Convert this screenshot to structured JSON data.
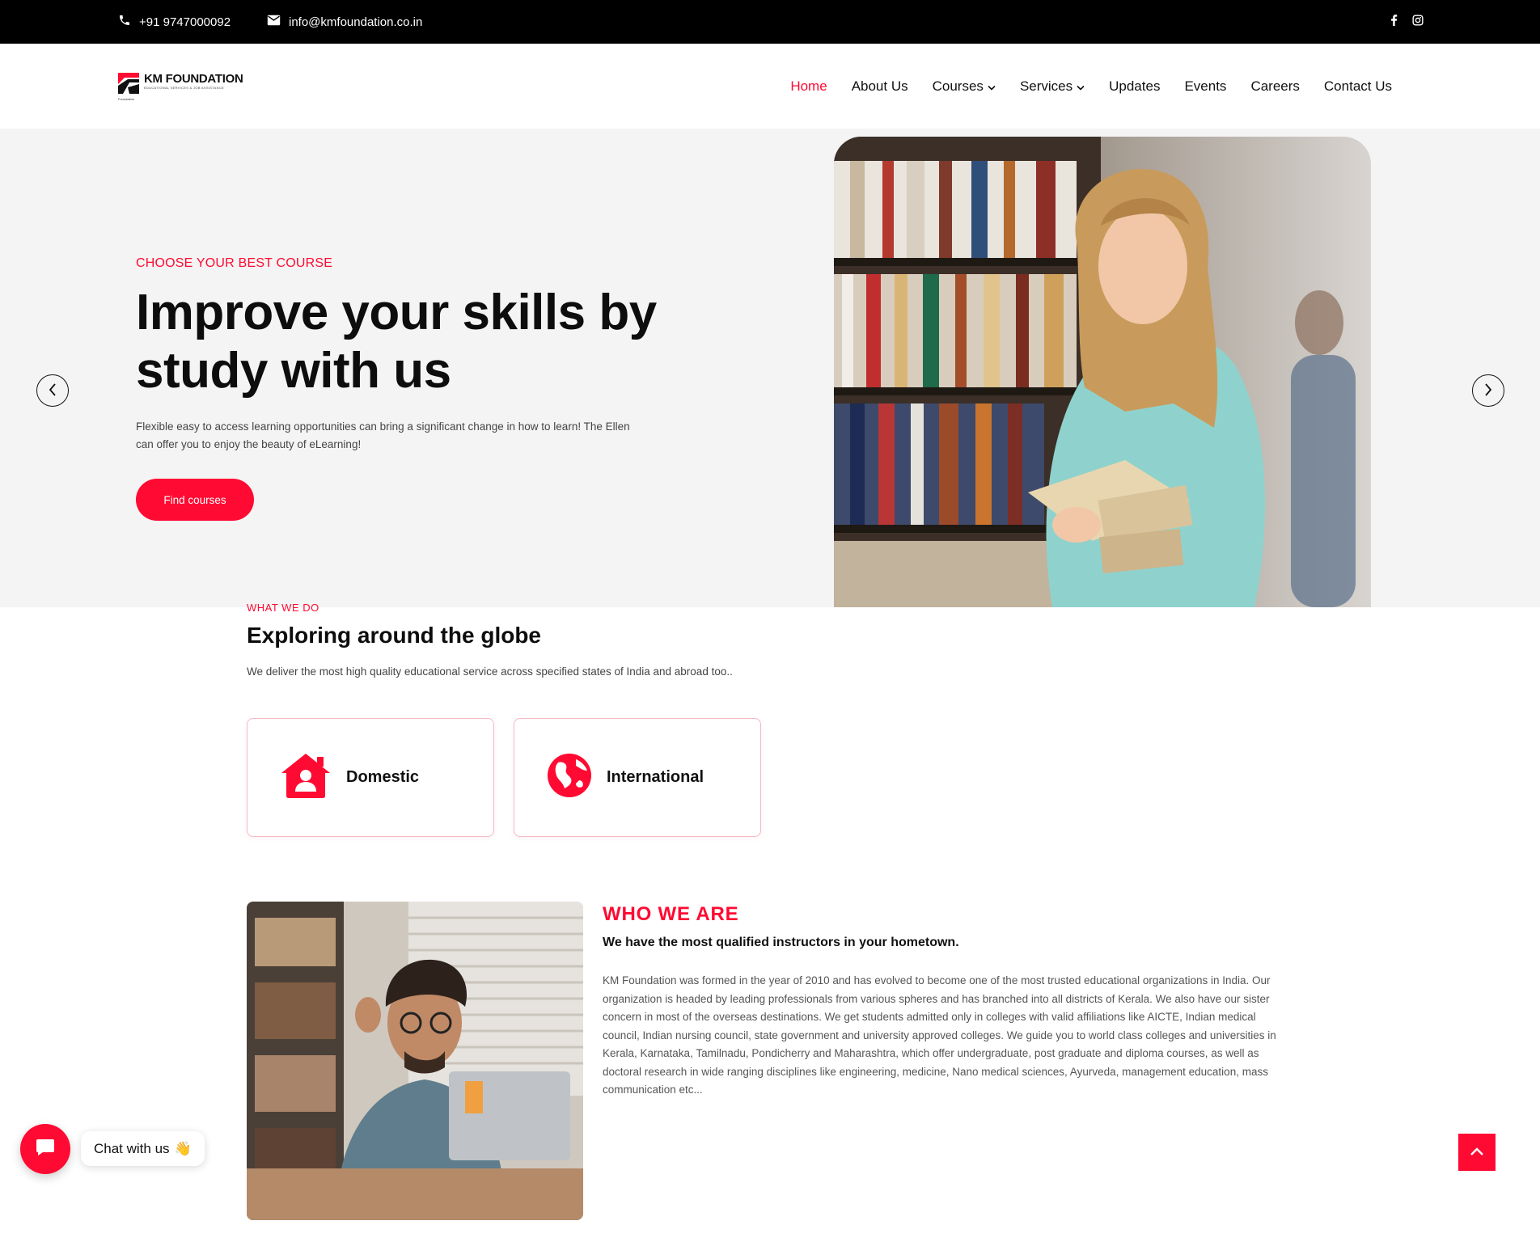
{
  "topbar": {
    "phone": "+91 9747000092",
    "email": "info@kmfoundation.co.in",
    "social": [
      "facebook-icon",
      "instagram-icon"
    ]
  },
  "logo": {
    "name": "KM FOUNDATION",
    "tagline": "EDUCATIONAL SERVICES & JOB ASSISTANCE",
    "sub": "Foundation"
  },
  "nav": {
    "items": [
      {
        "label": "Home",
        "active": true
      },
      {
        "label": "About Us"
      },
      {
        "label": "Courses",
        "dropdown": true
      },
      {
        "label": "Services",
        "dropdown": true
      },
      {
        "label": "Updates"
      },
      {
        "label": "Events"
      },
      {
        "label": "Careers"
      },
      {
        "label": "Contact Us"
      }
    ]
  },
  "hero": {
    "kicker": "CHOOSE YOUR BEST COURSE",
    "title": "Improve your skills by study with us",
    "description": "Flexible easy to access learning opportunities can bring a significant change in how to learn! The Ellen can offer you to enjoy the beauty of eLearning!",
    "button": "Find courses"
  },
  "what_we_do": {
    "kicker": "WHAT WE DO",
    "title": "Exploring around the globe",
    "description": "We deliver the most high quality educational service across specified states of India and abroad too..",
    "cards": [
      {
        "label": "Domestic",
        "icon": "house-user-icon"
      },
      {
        "label": "International",
        "icon": "globe-icon"
      }
    ]
  },
  "who_we_are": {
    "kicker": "WHO WE ARE",
    "subtitle": "We have the most qualified instructors in your hometown.",
    "body": "KM Foundation was formed in the year of 2010 and has evolved to become one of the most trusted educational organizations in India. Our organization is headed by leading professionals from various spheres and has branched into all districts of Kerala. We also have our sister concern in most of the overseas destinations. We get students admitted only in colleges with valid affiliations like AICTE, Indian medical council, Indian nursing council, state government and university approved colleges. We guide you to world class colleges and universities in Kerala, Karnataka, Tamilnadu, Pondicherry and Maharashtra, which offer undergraduate, post graduate and diploma courses, as well as doctoral research in wide ranging disciplines like engineering, medicine, Nano medical sciences, Ayurveda, management education, mass communication etc..."
  },
  "chat": {
    "label": "Chat with us",
    "emoji": "👋"
  },
  "colors": {
    "accent": "#ff0a32",
    "topbar": "#000000",
    "hero_bg": "#f4f4f4"
  }
}
